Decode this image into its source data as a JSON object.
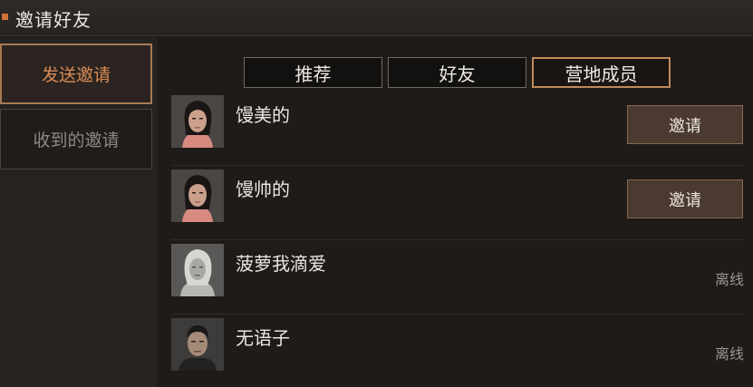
{
  "header": {
    "title": "邀请好友"
  },
  "sidebar": {
    "send_label": "发送邀请",
    "received_label": "收到的邀请"
  },
  "tabs": [
    {
      "label": "推荐",
      "active": false
    },
    {
      "label": "好友",
      "active": false
    },
    {
      "label": "营地成员",
      "active": true
    }
  ],
  "players": [
    {
      "name": "馒美的",
      "avatar": "female-avatar",
      "action": "邀请",
      "status": ""
    },
    {
      "name": "馒帅的",
      "avatar": "female-avatar",
      "action": "邀请",
      "status": ""
    },
    {
      "name": "菠萝我滴爱",
      "avatar": "grayscale-female-avatar",
      "action": "",
      "status": "离线"
    },
    {
      "name": "无语子",
      "avatar": "male-avatar",
      "action": "",
      "status": "离线"
    }
  ],
  "colors": {
    "accent": "#d0713a",
    "active_border": "#c08a5c",
    "invite_bg": "#4a3a30"
  }
}
